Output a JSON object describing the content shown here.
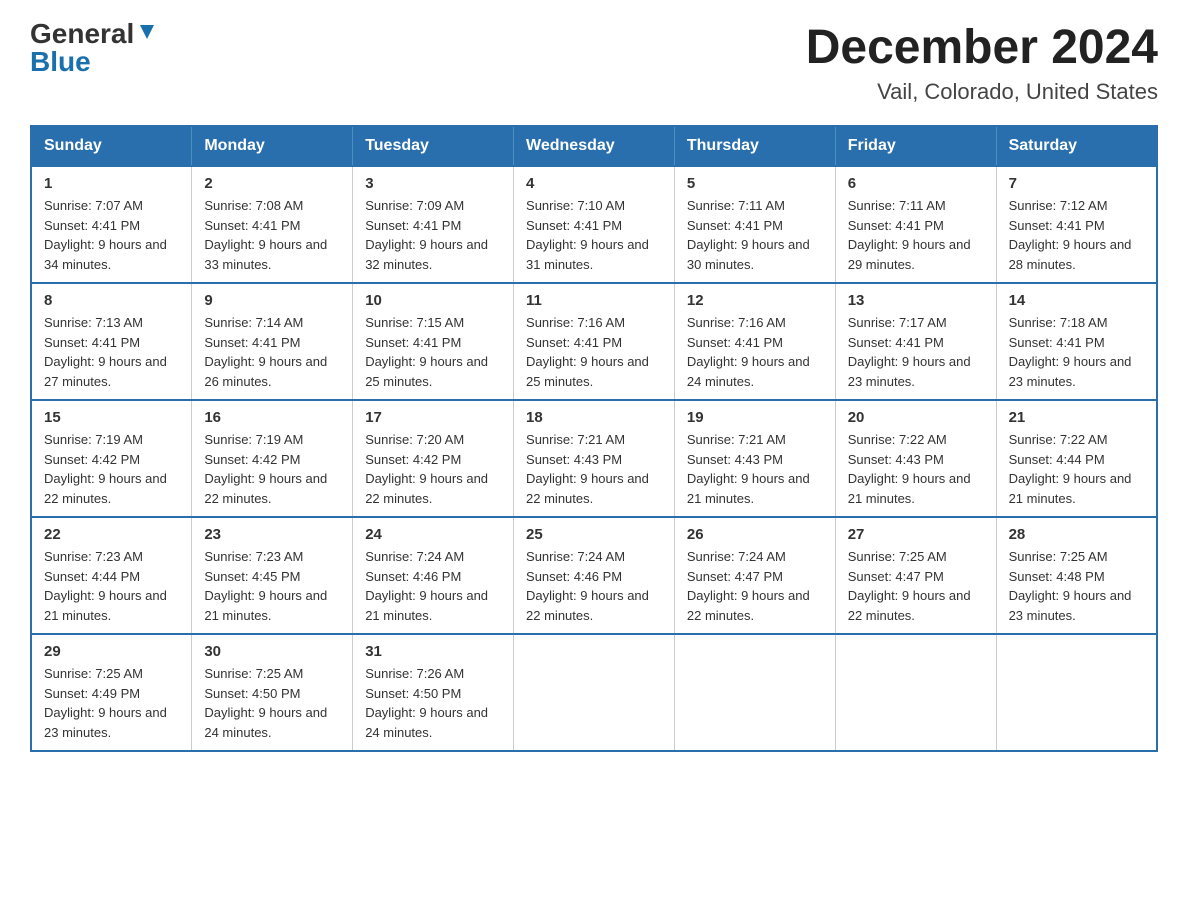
{
  "logo": {
    "general": "General",
    "blue": "Blue"
  },
  "title": "December 2024",
  "location": "Vail, Colorado, United States",
  "days_of_week": [
    "Sunday",
    "Monday",
    "Tuesday",
    "Wednesday",
    "Thursday",
    "Friday",
    "Saturday"
  ],
  "weeks": [
    [
      {
        "day": "1",
        "sunrise": "7:07 AM",
        "sunset": "4:41 PM",
        "daylight": "9 hours and 34 minutes."
      },
      {
        "day": "2",
        "sunrise": "7:08 AM",
        "sunset": "4:41 PM",
        "daylight": "9 hours and 33 minutes."
      },
      {
        "day": "3",
        "sunrise": "7:09 AM",
        "sunset": "4:41 PM",
        "daylight": "9 hours and 32 minutes."
      },
      {
        "day": "4",
        "sunrise": "7:10 AM",
        "sunset": "4:41 PM",
        "daylight": "9 hours and 31 minutes."
      },
      {
        "day": "5",
        "sunrise": "7:11 AM",
        "sunset": "4:41 PM",
        "daylight": "9 hours and 30 minutes."
      },
      {
        "day": "6",
        "sunrise": "7:11 AM",
        "sunset": "4:41 PM",
        "daylight": "9 hours and 29 minutes."
      },
      {
        "day": "7",
        "sunrise": "7:12 AM",
        "sunset": "4:41 PM",
        "daylight": "9 hours and 28 minutes."
      }
    ],
    [
      {
        "day": "8",
        "sunrise": "7:13 AM",
        "sunset": "4:41 PM",
        "daylight": "9 hours and 27 minutes."
      },
      {
        "day": "9",
        "sunrise": "7:14 AM",
        "sunset": "4:41 PM",
        "daylight": "9 hours and 26 minutes."
      },
      {
        "day": "10",
        "sunrise": "7:15 AM",
        "sunset": "4:41 PM",
        "daylight": "9 hours and 25 minutes."
      },
      {
        "day": "11",
        "sunrise": "7:16 AM",
        "sunset": "4:41 PM",
        "daylight": "9 hours and 25 minutes."
      },
      {
        "day": "12",
        "sunrise": "7:16 AM",
        "sunset": "4:41 PM",
        "daylight": "9 hours and 24 minutes."
      },
      {
        "day": "13",
        "sunrise": "7:17 AM",
        "sunset": "4:41 PM",
        "daylight": "9 hours and 23 minutes."
      },
      {
        "day": "14",
        "sunrise": "7:18 AM",
        "sunset": "4:41 PM",
        "daylight": "9 hours and 23 minutes."
      }
    ],
    [
      {
        "day": "15",
        "sunrise": "7:19 AM",
        "sunset": "4:42 PM",
        "daylight": "9 hours and 22 minutes."
      },
      {
        "day": "16",
        "sunrise": "7:19 AM",
        "sunset": "4:42 PM",
        "daylight": "9 hours and 22 minutes."
      },
      {
        "day": "17",
        "sunrise": "7:20 AM",
        "sunset": "4:42 PM",
        "daylight": "9 hours and 22 minutes."
      },
      {
        "day": "18",
        "sunrise": "7:21 AM",
        "sunset": "4:43 PM",
        "daylight": "9 hours and 22 minutes."
      },
      {
        "day": "19",
        "sunrise": "7:21 AM",
        "sunset": "4:43 PM",
        "daylight": "9 hours and 21 minutes."
      },
      {
        "day": "20",
        "sunrise": "7:22 AM",
        "sunset": "4:43 PM",
        "daylight": "9 hours and 21 minutes."
      },
      {
        "day": "21",
        "sunrise": "7:22 AM",
        "sunset": "4:44 PM",
        "daylight": "9 hours and 21 minutes."
      }
    ],
    [
      {
        "day": "22",
        "sunrise": "7:23 AM",
        "sunset": "4:44 PM",
        "daylight": "9 hours and 21 minutes."
      },
      {
        "day": "23",
        "sunrise": "7:23 AM",
        "sunset": "4:45 PM",
        "daylight": "9 hours and 21 minutes."
      },
      {
        "day": "24",
        "sunrise": "7:24 AM",
        "sunset": "4:46 PM",
        "daylight": "9 hours and 21 minutes."
      },
      {
        "day": "25",
        "sunrise": "7:24 AM",
        "sunset": "4:46 PM",
        "daylight": "9 hours and 22 minutes."
      },
      {
        "day": "26",
        "sunrise": "7:24 AM",
        "sunset": "4:47 PM",
        "daylight": "9 hours and 22 minutes."
      },
      {
        "day": "27",
        "sunrise": "7:25 AM",
        "sunset": "4:47 PM",
        "daylight": "9 hours and 22 minutes."
      },
      {
        "day": "28",
        "sunrise": "7:25 AM",
        "sunset": "4:48 PM",
        "daylight": "9 hours and 23 minutes."
      }
    ],
    [
      {
        "day": "29",
        "sunrise": "7:25 AM",
        "sunset": "4:49 PM",
        "daylight": "9 hours and 23 minutes."
      },
      {
        "day": "30",
        "sunrise": "7:25 AM",
        "sunset": "4:50 PM",
        "daylight": "9 hours and 24 minutes."
      },
      {
        "day": "31",
        "sunrise": "7:26 AM",
        "sunset": "4:50 PM",
        "daylight": "9 hours and 24 minutes."
      },
      {
        "day": "",
        "sunrise": "",
        "sunset": "",
        "daylight": ""
      },
      {
        "day": "",
        "sunrise": "",
        "sunset": "",
        "daylight": ""
      },
      {
        "day": "",
        "sunrise": "",
        "sunset": "",
        "daylight": ""
      },
      {
        "day": "",
        "sunrise": "",
        "sunset": "",
        "daylight": ""
      }
    ]
  ],
  "labels": {
    "sunrise_prefix": "Sunrise: ",
    "sunset_prefix": "Sunset: ",
    "daylight_prefix": "Daylight: "
  }
}
